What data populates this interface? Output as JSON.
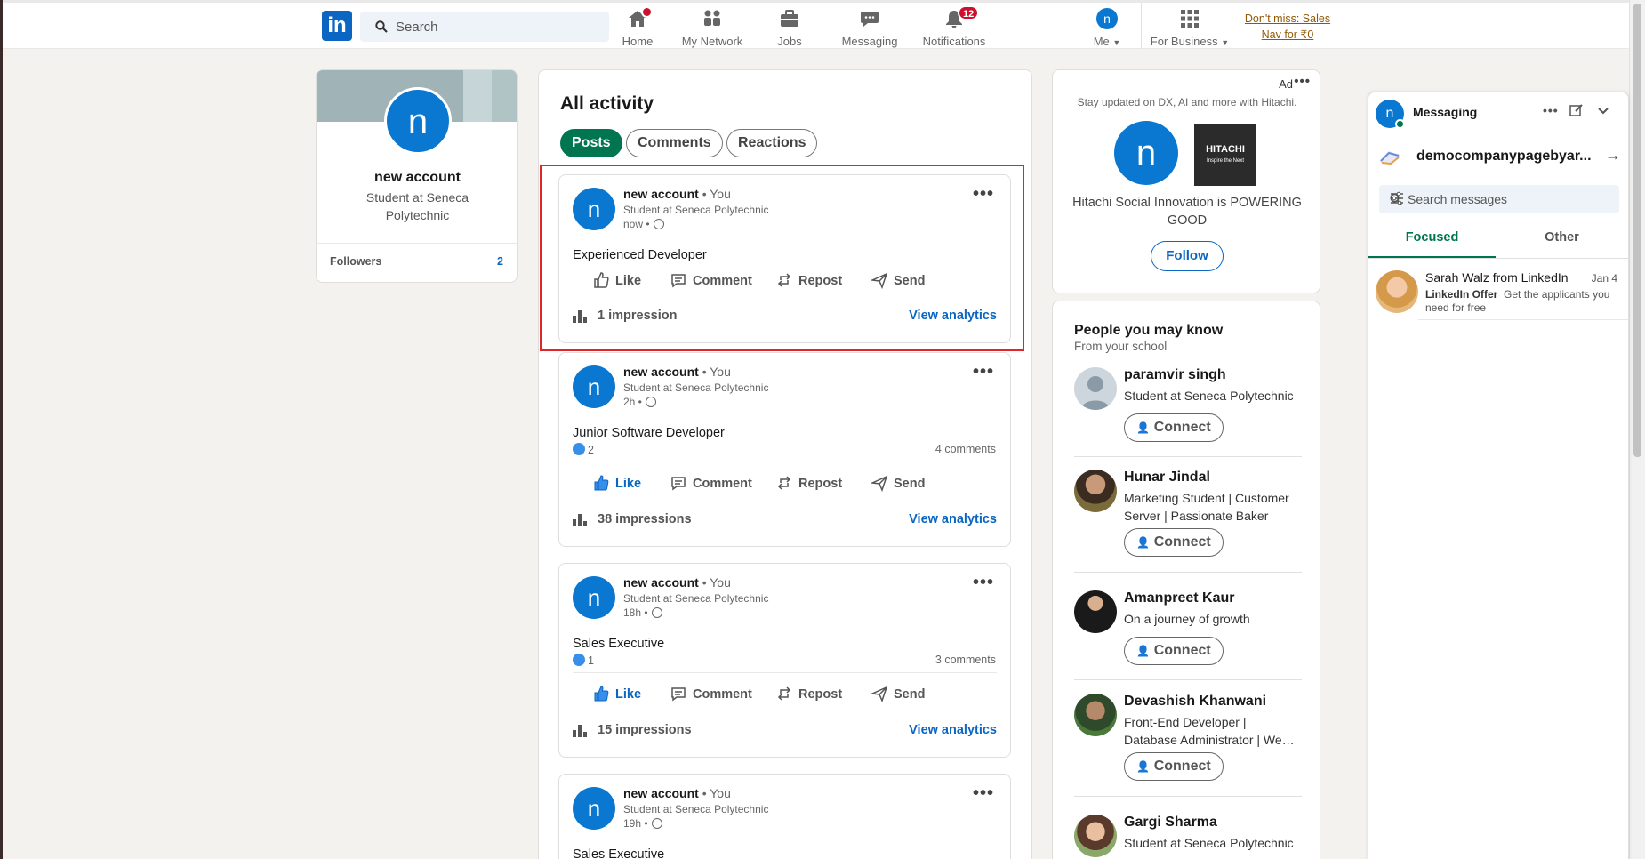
{
  "header": {
    "logo": "in",
    "search_placeholder": "Search",
    "nav": [
      {
        "label": "Home",
        "badge": ""
      },
      {
        "label": "My Network",
        "badge": ""
      },
      {
        "label": "Jobs",
        "badge": ""
      },
      {
        "label": "Messaging",
        "badge": ""
      },
      {
        "label": "Notifications",
        "badge": "12"
      },
      {
        "label": "Me",
        "badge": ""
      },
      {
        "label": "For Business",
        "badge": ""
      }
    ],
    "me_initial": "n",
    "promo_line1": "Don't miss: Sales",
    "promo_line2": "Nav for ₹0"
  },
  "profile": {
    "initial": "n",
    "name": "new account",
    "headline": "Student at Seneca Polytechnic",
    "followers_label": "Followers",
    "followers_count": "2"
  },
  "activity": {
    "title": "All activity",
    "tabs": [
      "Posts",
      "Comments",
      "Reactions"
    ],
    "posts": [
      {
        "initial": "n",
        "name": "new account",
        "you": "• You",
        "subtitle": "Student at Seneca Polytechnic",
        "time": "now •",
        "body": "Experienced Developer",
        "reactions": "",
        "comments": "",
        "like": "Like",
        "comment": "Comment",
        "repost": "Repost",
        "send": "Send",
        "impressions": "1 impression",
        "analytics": "View analytics"
      },
      {
        "initial": "n",
        "name": "new account",
        "you": "• You",
        "subtitle": "Student at Seneca Polytechnic",
        "time": "2h •",
        "body": "Junior Software Developer",
        "reactions": "2",
        "comments": "4 comments",
        "like": "Like",
        "comment": "Comment",
        "repost": "Repost",
        "send": "Send",
        "impressions": "38 impressions",
        "analytics": "View analytics"
      },
      {
        "initial": "n",
        "name": "new account",
        "you": "• You",
        "subtitle": "Student at Seneca Polytechnic",
        "time": "18h •",
        "body": "Sales Executive",
        "reactions": "1",
        "comments": "3 comments",
        "like": "Like",
        "comment": "Comment",
        "repost": "Repost",
        "send": "Send",
        "impressions": "15 impressions",
        "analytics": "View analytics"
      },
      {
        "initial": "n",
        "name": "new account",
        "you": "• You",
        "subtitle": "Student at Seneca Polytechnic",
        "time": "19h •",
        "body": "Sales Executive"
      }
    ]
  },
  "ad": {
    "label": "Ad",
    "subtitle": "Stay updated on DX, AI and more with Hitachi.",
    "initial": "n",
    "brand": "HITACHI",
    "brand_tagline": "Inspire the Next",
    "text": "Hitachi Social Innovation is POWERING GOOD",
    "follow": "Follow"
  },
  "people": {
    "title": "People you may know",
    "subtitle": "From your school",
    "connect_label": "Connect",
    "list": [
      {
        "name": "paramvir singh",
        "headline": "Student at Seneca Polytechnic"
      },
      {
        "name": "Hunar Jindal",
        "headline": "Marketing Student | Customer Server | Passionate Baker"
      },
      {
        "name": "Amanpreet Kaur",
        "headline": "On a journey of growth"
      },
      {
        "name": "Devashish Khanwani",
        "headline": "Front-End Developer | Database Administrator | We…"
      },
      {
        "name": "Gargi Sharma",
        "headline": "Student at Seneca Polytechnic"
      }
    ]
  },
  "messaging": {
    "initial": "n",
    "title": "Messaging",
    "company": "democompanypagebyar...",
    "search_placeholder": "Search messages",
    "tabs": [
      "Focused",
      "Other"
    ],
    "conversation": {
      "name": "Sarah Walz from LinkedIn",
      "date": "Jan 4",
      "tag": "LinkedIn Offer",
      "preview": "Get the applicants you need for free"
    }
  },
  "colors": {
    "brand": "#0a66c2",
    "green_active": "#01754f",
    "highlight": "#e0262b",
    "badge": "#cb112d"
  }
}
